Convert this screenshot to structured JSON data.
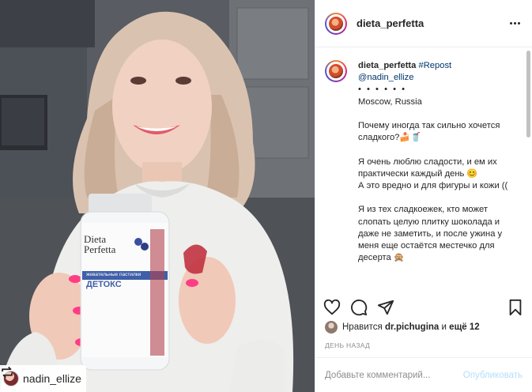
{
  "post": {
    "username": "dieta_perfetta",
    "repost_username": "nadin_ellize",
    "product": {
      "brand_line1": "Dieta",
      "brand_line2": "Perfetta",
      "subtitle": "жевательные пастилки",
      "name": "ДЕТОКС"
    }
  },
  "caption": {
    "username": "dieta_perfetta",
    "tag": "#Repost",
    "mention": "@nadin_ellize",
    "dots": "• • • • • •",
    "location": "Moscow, Russia",
    "paragraphs": [
      "Почему иногда так сильно хочется сладкого?🍰🥤",
      "Я очень люблю сладости, и ем их практически каждый день 😊",
      "А это вредно и для фигуры и кожи ((",
      "Я из тех сладкоежек, кто может слопать целую плитку шоколада и даже не заметить, и после ужина у меня еще остаётся местечко для десерта 🙊"
    ]
  },
  "icons": {
    "like": "heart-icon",
    "comment": "comment-icon",
    "share": "share-icon",
    "save": "bookmark-icon",
    "more": "more-options-icon",
    "repost": "repost-icon"
  },
  "likes": {
    "prefix": "Нравится",
    "user": "dr.pichugina",
    "middle": "и",
    "others": "ещё 12"
  },
  "time_ago": "ДЕНЬ НАЗАД",
  "comment_form": {
    "placeholder": "Добавьте комментарий...",
    "submit": "Опубликовать"
  },
  "colors": {
    "link": "#00376b",
    "publish_disabled": "#b2dffc",
    "muted": "#8e8e8e"
  }
}
